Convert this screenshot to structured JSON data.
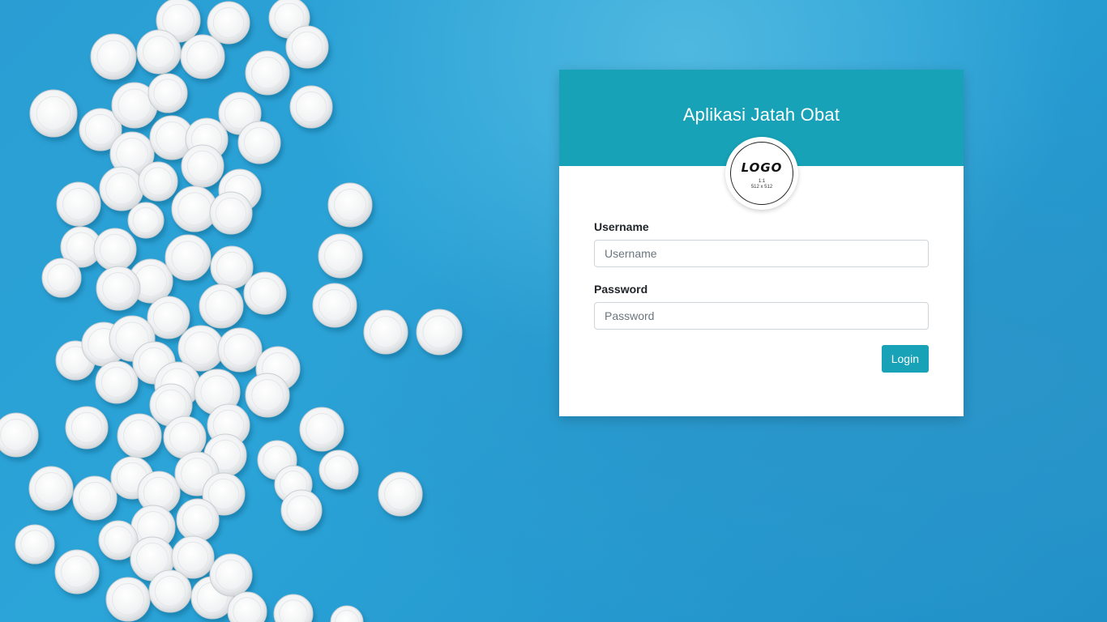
{
  "app": {
    "title": "Aplikasi Jatah Obat"
  },
  "logo": {
    "text": "LOGO",
    "sub_line1": "1:1",
    "sub_line2": "512 x 512"
  },
  "form": {
    "username_label": "Username",
    "username_placeholder": "Username",
    "username_value": "",
    "password_label": "Password",
    "password_placeholder": "Password",
    "password_value": "",
    "login_label": "Login"
  },
  "colors": {
    "accent": "#17a2b8",
    "background": "#2a9ed3"
  },
  "icons": {
    "background_image": "white-pills-image"
  }
}
